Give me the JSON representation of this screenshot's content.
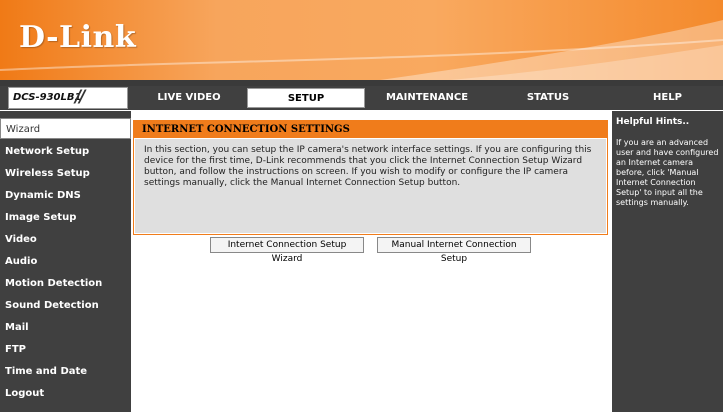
{
  "brand": {
    "logo": "D-Link",
    "model": "DCS-930LB1",
    "model_slash": "//"
  },
  "tabs": [
    {
      "label": "LIVE VIDEO"
    },
    {
      "label": "SETUP"
    },
    {
      "label": "MAINTENANCE"
    },
    {
      "label": "STATUS"
    },
    {
      "label": "HELP"
    }
  ],
  "sidebar": {
    "items": [
      {
        "label": "Wizard"
      },
      {
        "label": "Network Setup"
      },
      {
        "label": "Wireless Setup"
      },
      {
        "label": "Dynamic DNS"
      },
      {
        "label": "Image Setup"
      },
      {
        "label": "Video"
      },
      {
        "label": "Audio"
      },
      {
        "label": "Motion Detection"
      },
      {
        "label": "Sound Detection"
      },
      {
        "label": "Mail"
      },
      {
        "label": "FTP"
      },
      {
        "label": "Time and Date"
      },
      {
        "label": "Logout"
      }
    ]
  },
  "main": {
    "title": "INTERNET CONNECTION SETTINGS",
    "description": "In this section, you can setup the IP camera's network interface settings. If you are configuring this device for the first time, D-Link recommends that you click the Internet Connection Setup Wizard button, and follow the instructions on screen. If you wish to modify or configure the IP camera settings manually, click the Manual Internet Connection Setup button.",
    "wizard_button": "Internet Connection Setup Wizard",
    "manual_button": "Manual Internet Connection Setup"
  },
  "hints": {
    "title": "Helpful Hints..",
    "text": "If you are an advanced user and have configured an Internet camera before, click 'Manual Internet Connection Setup' to input all the settings manually."
  },
  "colors": {
    "accent": "#f07c1b",
    "dark": "#404040",
    "panel_bg": "#dfdfdf"
  }
}
